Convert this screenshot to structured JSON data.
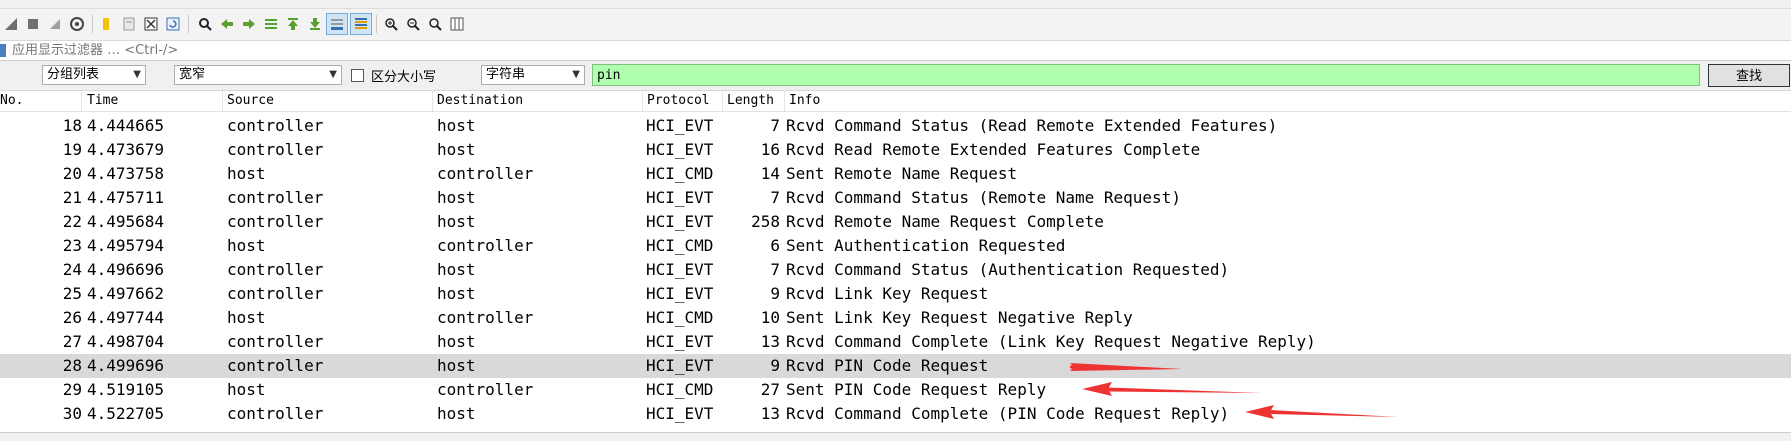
{
  "filter": {
    "placeholder": "应用显示过滤器 … <Ctrl-/>"
  },
  "search": {
    "scope": "分组列表",
    "width_mode": "宽窄",
    "case_label": "区分大小写",
    "type": "字符串",
    "query": "pin",
    "find_label": "查找"
  },
  "columns": {
    "no": "No.",
    "time": "Time",
    "source": "Source",
    "destination": "Destination",
    "protocol": "Protocol",
    "length": "Length",
    "info": "Info"
  },
  "packets": [
    {
      "no": "18",
      "time": "4.444665",
      "src": "controller",
      "dst": "host",
      "proto": "HCI_EVT",
      "len": "7",
      "info": "Rcvd Command Status (Read Remote Extended Features)"
    },
    {
      "no": "19",
      "time": "4.473679",
      "src": "controller",
      "dst": "host",
      "proto": "HCI_EVT",
      "len": "16",
      "info": "Rcvd Read Remote Extended Features Complete"
    },
    {
      "no": "20",
      "time": "4.473758",
      "src": "host",
      "dst": "controller",
      "proto": "HCI_CMD",
      "len": "14",
      "info": "Sent Remote Name Request"
    },
    {
      "no": "21",
      "time": "4.475711",
      "src": "controller",
      "dst": "host",
      "proto": "HCI_EVT",
      "len": "7",
      "info": "Rcvd Command Status (Remote Name Request)"
    },
    {
      "no": "22",
      "time": "4.495684",
      "src": "controller",
      "dst": "host",
      "proto": "HCI_EVT",
      "len": "258",
      "info": "Rcvd Remote Name Request Complete"
    },
    {
      "no": "23",
      "time": "4.495794",
      "src": "host",
      "dst": "controller",
      "proto": "HCI_CMD",
      "len": "6",
      "info": "Sent Authentication Requested"
    },
    {
      "no": "24",
      "time": "4.496696",
      "src": "controller",
      "dst": "host",
      "proto": "HCI_EVT",
      "len": "7",
      "info": "Rcvd Command Status (Authentication Requested)"
    },
    {
      "no": "25",
      "time": "4.497662",
      "src": "controller",
      "dst": "host",
      "proto": "HCI_EVT",
      "len": "9",
      "info": "Rcvd Link Key Request"
    },
    {
      "no": "26",
      "time": "4.497744",
      "src": "host",
      "dst": "controller",
      "proto": "HCI_CMD",
      "len": "10",
      "info": "Sent Link Key Request Negative Reply"
    },
    {
      "no": "27",
      "time": "4.498704",
      "src": "controller",
      "dst": "host",
      "proto": "HCI_EVT",
      "len": "13",
      "info": "Rcvd Command Complete (Link Key Request Negative Reply)"
    },
    {
      "no": "28",
      "time": "4.499696",
      "src": "controller",
      "dst": "host",
      "proto": "HCI_EVT",
      "len": "9",
      "info": "Rcvd PIN Code Request"
    },
    {
      "no": "29",
      "time": "4.519105",
      "src": "host",
      "dst": "controller",
      "proto": "HCI_CMD",
      "len": "27",
      "info": "Sent PIN Code Request Reply"
    },
    {
      "no": "30",
      "time": "4.522705",
      "src": "controller",
      "dst": "host",
      "proto": "HCI_EVT",
      "len": "13",
      "info": "Rcvd Command Complete (PIN Code Request Reply)"
    }
  ],
  "selected_row": 28,
  "annotation_color": "#ee3333",
  "search_highlight_color": "#afffaf"
}
